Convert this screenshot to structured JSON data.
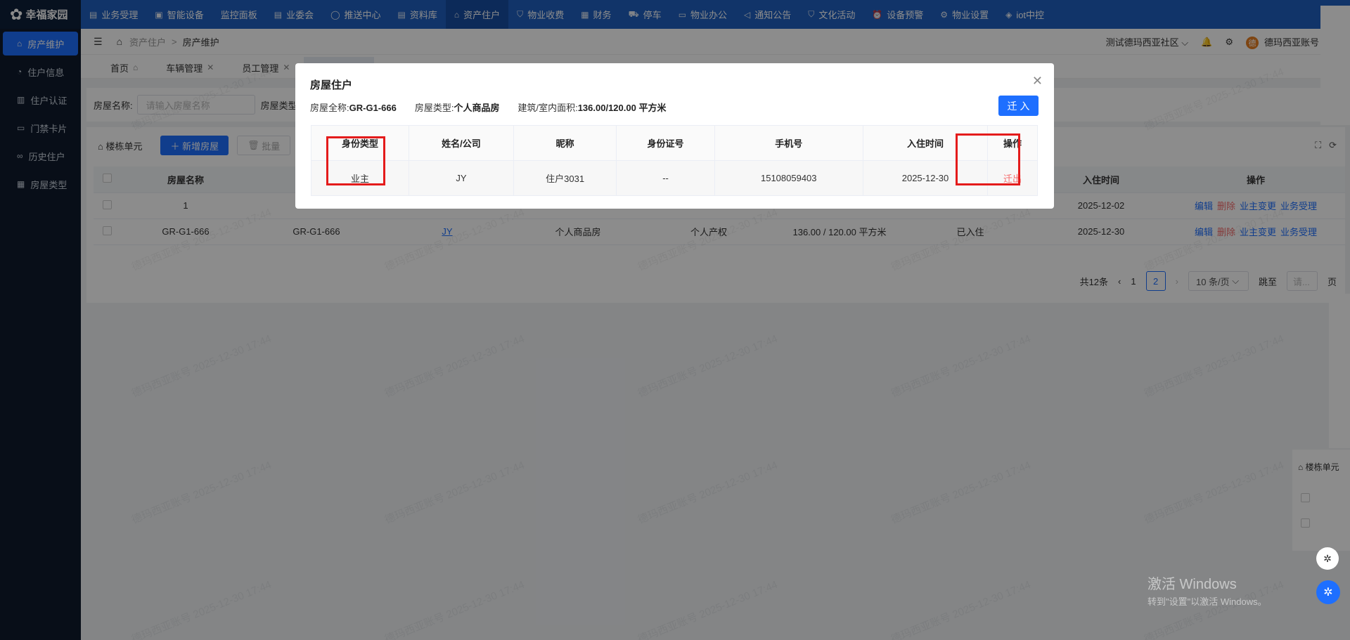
{
  "app": {
    "name": "幸福家园"
  },
  "topnav": {
    "items": [
      {
        "label": "业务受理",
        "icon": "doc-icon"
      },
      {
        "label": "智能设备",
        "icon": "device-icon"
      },
      {
        "label": "监控面板",
        "icon": ""
      },
      {
        "label": "业委会",
        "icon": "doc-icon"
      },
      {
        "label": "推送中心",
        "icon": "chat-icon"
      },
      {
        "label": "资料库",
        "icon": "doc-icon"
      },
      {
        "label": "资产住户",
        "icon": "home-icon",
        "active": true
      },
      {
        "label": "物业收费",
        "icon": "shield-icon"
      },
      {
        "label": "财务",
        "icon": "calendar-icon"
      },
      {
        "label": "停车",
        "icon": "car-icon"
      },
      {
        "label": "物业办公",
        "icon": "monitor-icon"
      },
      {
        "label": "通知公告",
        "icon": "megaphone-icon"
      },
      {
        "label": "文化活动",
        "icon": "shield-icon"
      },
      {
        "label": "设备预警",
        "icon": "alarm-icon"
      },
      {
        "label": "物业设置",
        "icon": "gear-icon"
      },
      {
        "label": "iot中控",
        "icon": "cube-icon"
      }
    ]
  },
  "sidebar": {
    "items": [
      {
        "label": "房产维护",
        "active": true
      },
      {
        "label": "住户信息"
      },
      {
        "label": "住户认证"
      },
      {
        "label": "门禁卡片"
      },
      {
        "label": "历史住户"
      },
      {
        "label": "房屋类型"
      }
    ]
  },
  "breadcrumb": {
    "parent": "资产住户",
    "separator": ">",
    "current": "房产维护"
  },
  "header": {
    "community": "测试德玛西亚社区",
    "account": "德玛西亚账号",
    "avatar_text": "德",
    "help": "帮助"
  },
  "tabs": [
    {
      "label": "首页"
    },
    {
      "label": "车辆管理"
    },
    {
      "label": "员工管理"
    }
  ],
  "filter": {
    "house_name_label": "房屋名称:",
    "house_name_placeholder": "请输入房屋名称",
    "house_type_label": "房屋类型"
  },
  "toolbar": {
    "tree_label": "楼栋单元",
    "add_label": "新增房屋",
    "batch_label": "批量"
  },
  "table": {
    "headers": [
      "房屋名称",
      "",
      "",
      "",
      "",
      "",
      "",
      "入住时间",
      "操作"
    ],
    "rows": [
      {
        "name": "1",
        "full": "",
        "owner": "",
        "type": "",
        "right": "",
        "area": "",
        "status": "",
        "time": "2025-12-02"
      },
      {
        "name": "GR-G1-666",
        "full": "GR-G1-666",
        "owner": "JY",
        "type": "个人商品房",
        "right": "个人产权",
        "area": "136.00 / 120.00 平方米",
        "status": "已入住",
        "time": "2025-12-30"
      }
    ],
    "ops": {
      "edit": "编辑",
      "delete": "删除",
      "change_owner": "业主变更",
      "business": "业务受理"
    }
  },
  "pager": {
    "total": "共12条",
    "page1": "1",
    "page2": "2",
    "page_size": "10 条/页",
    "goto": "跳至",
    "goto_placeholder": "请...",
    "page_unit": "页"
  },
  "watermark": "德玛西亚账号 2025-12-30 17:44",
  "modal": {
    "title": "房屋住户",
    "info": {
      "full_name_label": "房屋全称:",
      "full_name": "GR-G1-666",
      "type_label": "房屋类型:",
      "type": "个人商品房",
      "area_label": "建筑/室内面积:",
      "area": "136.00/120.00 平方米"
    },
    "move_in_button": "迁 入",
    "columns": [
      "身份类型",
      "姓名/公司",
      "昵称",
      "身份证号",
      "手机号",
      "入住时间",
      "操作"
    ],
    "rows": [
      {
        "identity": "业主",
        "name": "JY",
        "nickname": "住户3031",
        "id_no": "--",
        "phone": "15108059403",
        "move_in": "2025-12-30",
        "action": "迁出"
      }
    ]
  },
  "right_fragment": {
    "tree_label": "楼栋单元"
  },
  "system": {
    "activate_title": "激活 Windows",
    "activate_sub": "转到\"设置\"以激活 Windows。"
  },
  "colors": {
    "primary": "#1e6fff",
    "nav": "#1f5fbf",
    "sidebar": "#0f1b2d",
    "danger": "#f56c6c",
    "highlight": "#e41b1b"
  }
}
